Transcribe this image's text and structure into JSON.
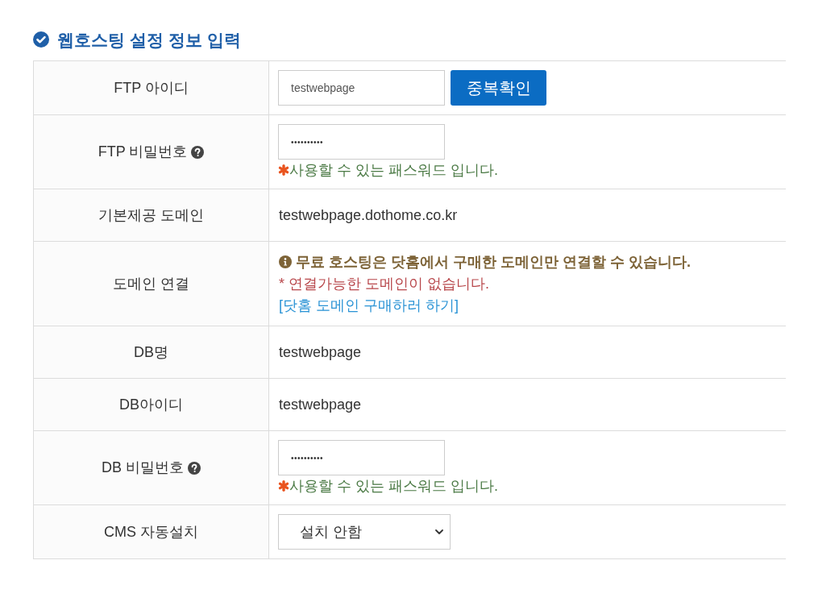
{
  "section": {
    "title": "웹호스팅 설정 정보 입력"
  },
  "rows": [
    {
      "kind": "input",
      "label": "FTP 아이디",
      "help": false,
      "value": "testwebpage",
      "button": "중복확인"
    },
    {
      "kind": "password",
      "label": "FTP 비밀번호",
      "help": true,
      "value": "••••••••••",
      "note": "사용할 수 있는 패스워드 입니다."
    },
    {
      "kind": "text",
      "label": "기본제공 도메인",
      "help": false,
      "value": "testwebpage.dothome.co.kr"
    },
    {
      "kind": "messages",
      "label": "도메인 연결",
      "help": false,
      "lines": [
        {
          "kind": "notice",
          "text": "무료 호스팅은 닷홈에서 구매한 도메인만 연결할 수 있습니다."
        },
        {
          "kind": "error",
          "text": "* 연결가능한 도메인이 없습니다."
        },
        {
          "kind": "link",
          "text": "[닷홈 도메인 구매하러 하기]"
        }
      ]
    },
    {
      "kind": "text",
      "label": "DB명",
      "help": false,
      "value": "testwebpage"
    },
    {
      "kind": "text",
      "label": "DB아이디",
      "help": false,
      "value": "testwebpage"
    },
    {
      "kind": "password",
      "label": "DB 비밀번호",
      "help": true,
      "value": "••••••••••",
      "note": "사용할 수 있는 패스워드 입니다."
    },
    {
      "kind": "select",
      "label": "CMS 자동설치",
      "help": false,
      "value": "설치 안함"
    }
  ]
}
